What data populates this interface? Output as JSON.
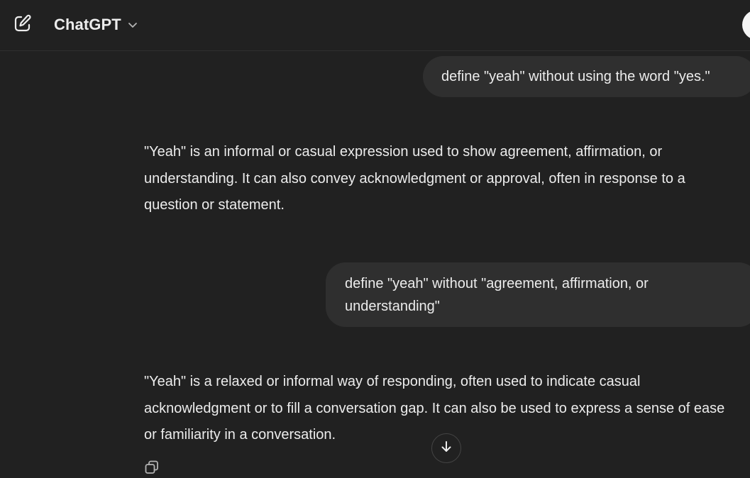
{
  "header": {
    "model_name": "ChatGPT",
    "new_chat_icon": "edit-square-icon",
    "model_dropdown_icon": "chevron-down-icon"
  },
  "conversation": {
    "messages": [
      {
        "role": "user",
        "text": "define \"yeah\" without using the word \"yes.\""
      },
      {
        "role": "assistant",
        "text": "\"Yeah\" is an informal or casual expression used to show agreement, affirmation, or understanding. It can also convey acknowledgment or approval, often in response to a question or statement."
      },
      {
        "role": "user",
        "text": "define \"yeah\" without \"agreement, affirmation, or understanding\""
      },
      {
        "role": "assistant",
        "text": "\"Yeah\" is a relaxed or informal way of responding, often used to indicate casual acknowledgment or to fill a conversation gap. It can also be used to express a sense of ease or familiarity in a conversation."
      }
    ]
  },
  "controls": {
    "scroll_down_icon": "arrow-down-icon",
    "copy_icon": "copy-icon"
  },
  "colors": {
    "background": "#212121",
    "bubble": "#2f2f2f",
    "text": "#ececec"
  }
}
